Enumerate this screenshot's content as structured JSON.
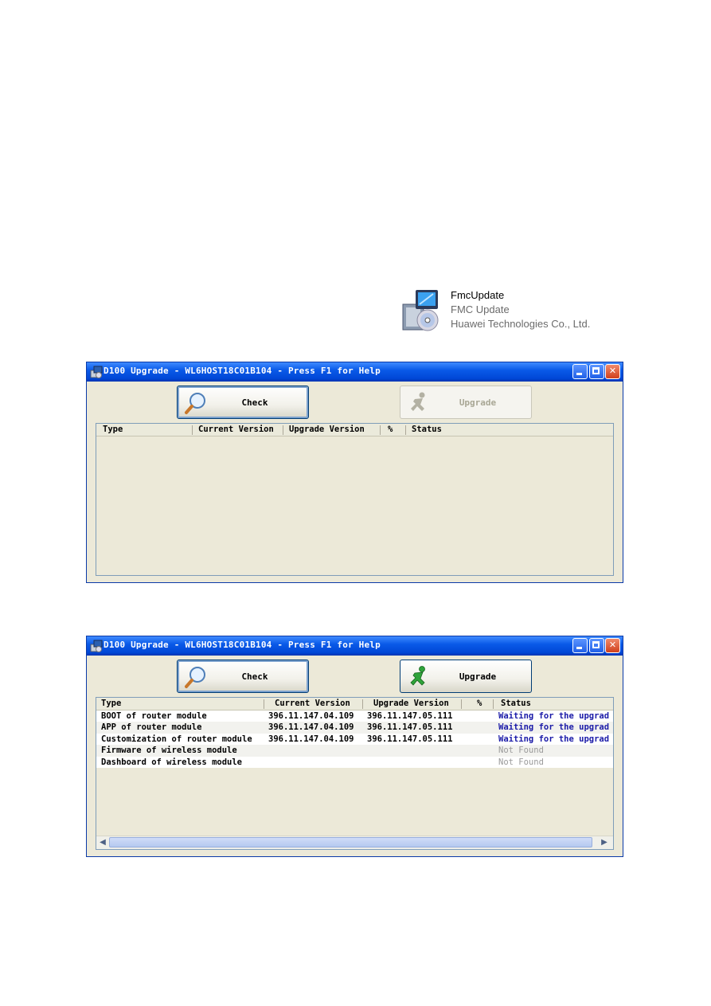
{
  "file": {
    "name": "FmcUpdate",
    "description": "FMC Update",
    "company": "Huawei Technologies Co., Ltd."
  },
  "window": {
    "title": "D100 Upgrade - WL6HOST18C01B104 - Press F1 for Help",
    "check_label": "Check",
    "upgrade_label": "Upgrade",
    "columns": [
      "Type",
      "Current Version",
      "Upgrade Version",
      "%",
      "Status"
    ]
  },
  "rows": [
    {
      "type": "BOOT of router module",
      "current": "396.11.147.04.109",
      "upgrade": "396.11.147.05.111",
      "percent": "",
      "status": "Waiting for the upgrad"
    },
    {
      "type": "APP of router module",
      "current": "396.11.147.04.109",
      "upgrade": "396.11.147.05.111",
      "percent": "",
      "status": "Waiting for the upgrad"
    },
    {
      "type": "Customization of router module",
      "current": "396.11.147.04.109",
      "upgrade": "396.11.147.05.111",
      "percent": "",
      "status": "Waiting for the upgrad"
    },
    {
      "type": "Firmware of wireless module",
      "current": "",
      "upgrade": "",
      "percent": "",
      "status": "Not Found"
    },
    {
      "type": "Dashboard of wireless module",
      "current": "",
      "upgrade": "",
      "percent": "",
      "status": "Not Found"
    }
  ],
  "colors": {
    "titlebar": "#0a5ae8",
    "status_waiting": "#1a1aa8",
    "status_not_found": "#9a9a9a"
  }
}
